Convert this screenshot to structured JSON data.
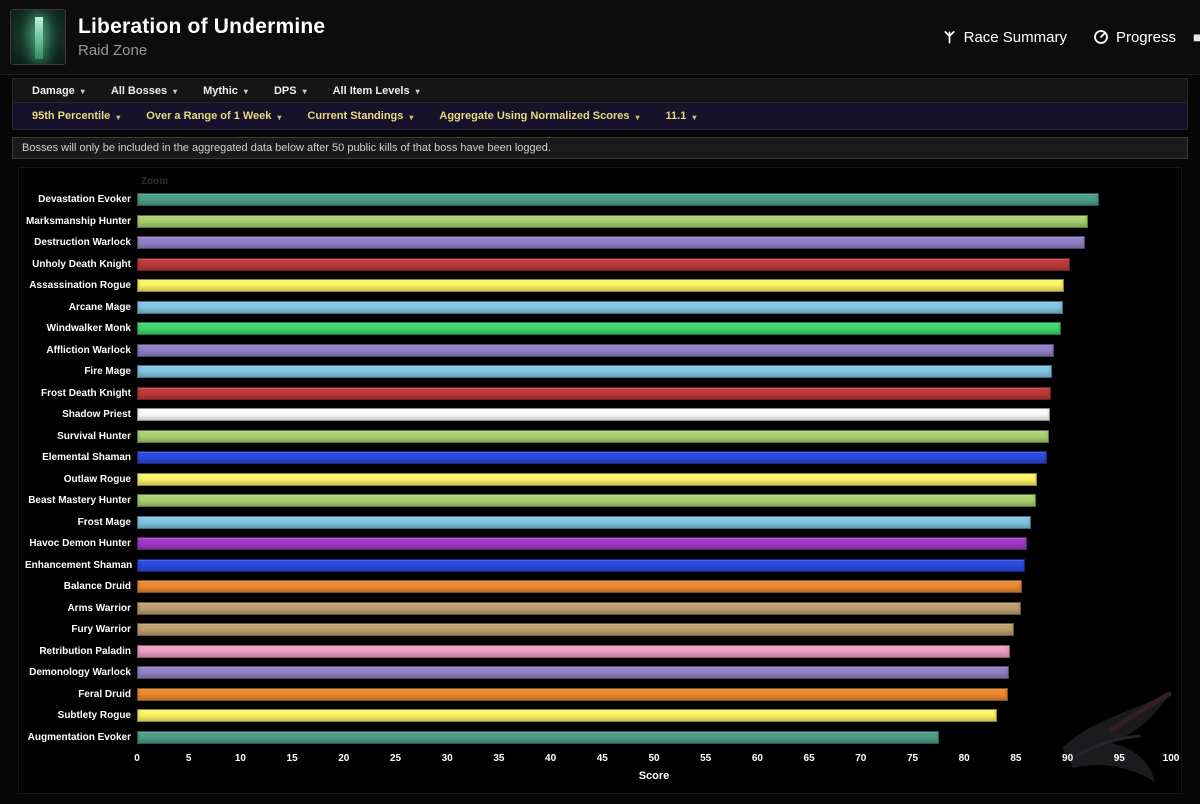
{
  "header": {
    "title": "Liberation of Undermine",
    "subtitle": "Raid Zone",
    "nav": [
      {
        "label": "Race Summary",
        "icon": "race-summary-icon"
      },
      {
        "label": "Progress",
        "icon": "progress-icon"
      }
    ]
  },
  "filters_primary": [
    {
      "label": "Damage"
    },
    {
      "label": "All Bosses"
    },
    {
      "label": "Mythic"
    },
    {
      "label": "DPS"
    },
    {
      "label": "All Item Levels"
    }
  ],
  "filters_secondary": [
    {
      "label": "95th Percentile"
    },
    {
      "label": "Over a Range of 1 Week"
    },
    {
      "label": "Current Standings"
    },
    {
      "label": "Aggregate Using Normalized Scores"
    },
    {
      "label": "11.1"
    }
  ],
  "notice": "Bosses will only be included in the aggregated data below after 50 public kills of that boss have been logged.",
  "chart_data": {
    "type": "bar",
    "orientation": "horizontal",
    "zoom_label": "Zoom",
    "xlabel": "Score",
    "xlim": [
      0,
      100
    ],
    "xticks": [
      0,
      5,
      10,
      15,
      20,
      25,
      30,
      35,
      40,
      45,
      50,
      55,
      60,
      65,
      70,
      75,
      80,
      85,
      90,
      95,
      100
    ],
    "grid": false,
    "categories": [
      "Devastation Evoker",
      "Marksmanship Hunter",
      "Destruction Warlock",
      "Unholy Death Knight",
      "Assassination Rogue",
      "Arcane Mage",
      "Windwalker Monk",
      "Affliction Warlock",
      "Fire Mage",
      "Frost Death Knight",
      "Shadow Priest",
      "Survival Hunter",
      "Elemental Shaman",
      "Outlaw Rogue",
      "Beast Mastery Hunter",
      "Frost Mage",
      "Havoc Demon Hunter",
      "Enhancement Shaman",
      "Balance Druid",
      "Arms Warrior",
      "Fury Warrior",
      "Retribution Paladin",
      "Demonology Warlock",
      "Feral Druid",
      "Subtlety Rogue",
      "Augmentation Evoker"
    ],
    "values": [
      93.0,
      92.0,
      91.7,
      90.2,
      89.7,
      89.6,
      89.4,
      88.7,
      88.5,
      88.4,
      88.3,
      88.2,
      88.0,
      87.0,
      86.9,
      86.5,
      86.1,
      85.9,
      85.6,
      85.5,
      84.8,
      84.4,
      84.3,
      84.2,
      83.2,
      77.6
    ],
    "colors": [
      "#4FA08A",
      "#AAD372",
      "#9482C9",
      "#C03B3B",
      "#FFF569",
      "#82C8E5",
      "#3FD96E",
      "#9482C9",
      "#82C8E5",
      "#C03B3B",
      "#FFFFFF",
      "#AAD372",
      "#2B4AE2",
      "#FFF569",
      "#AAD372",
      "#82C8E5",
      "#A33BC9",
      "#2B4AE2",
      "#EE8A33",
      "#C0A070",
      "#C0A070",
      "#F0A0C4",
      "#9482C9",
      "#EE8A33",
      "#FFF569",
      "#4FA08A"
    ]
  }
}
